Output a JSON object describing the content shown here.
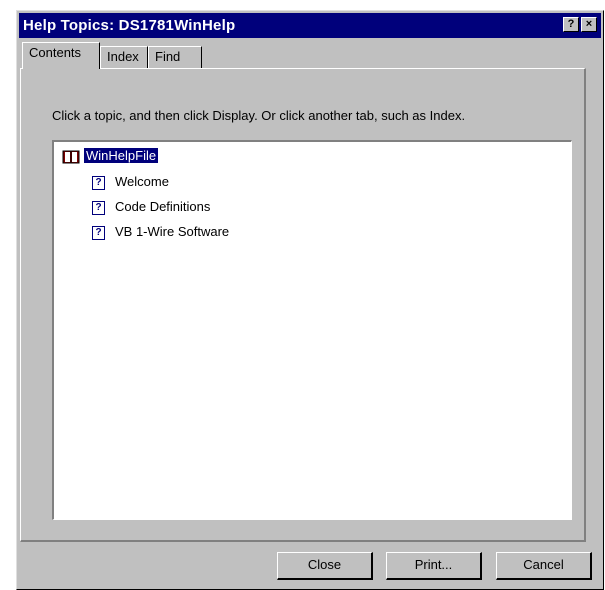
{
  "window": {
    "title": "Help Topics: DS1781WinHelp",
    "help_button": "?",
    "close_button": "×"
  },
  "tabs": [
    {
      "label": "Contents",
      "active": true
    },
    {
      "label": "Index",
      "active": false
    },
    {
      "label": "Find",
      "active": false
    }
  ],
  "instruction": "Click a topic, and then click Display. Or click another tab, such as Index.",
  "tree": {
    "root": {
      "label": "WinHelpFile",
      "icon": "book-icon",
      "selected": true
    },
    "children": [
      {
        "label": "Welcome",
        "icon": "help-page-icon"
      },
      {
        "label": "Code Definitions",
        "icon": "help-page-icon"
      },
      {
        "label": "VB 1-Wire Software",
        "icon": "help-page-icon"
      }
    ]
  },
  "buttons": {
    "close": "Close",
    "print": "Print...",
    "cancel": "Cancel"
  },
  "colors": {
    "titlebar": "#00007b",
    "face": "#c0c0c0",
    "selection": "#00007b"
  }
}
